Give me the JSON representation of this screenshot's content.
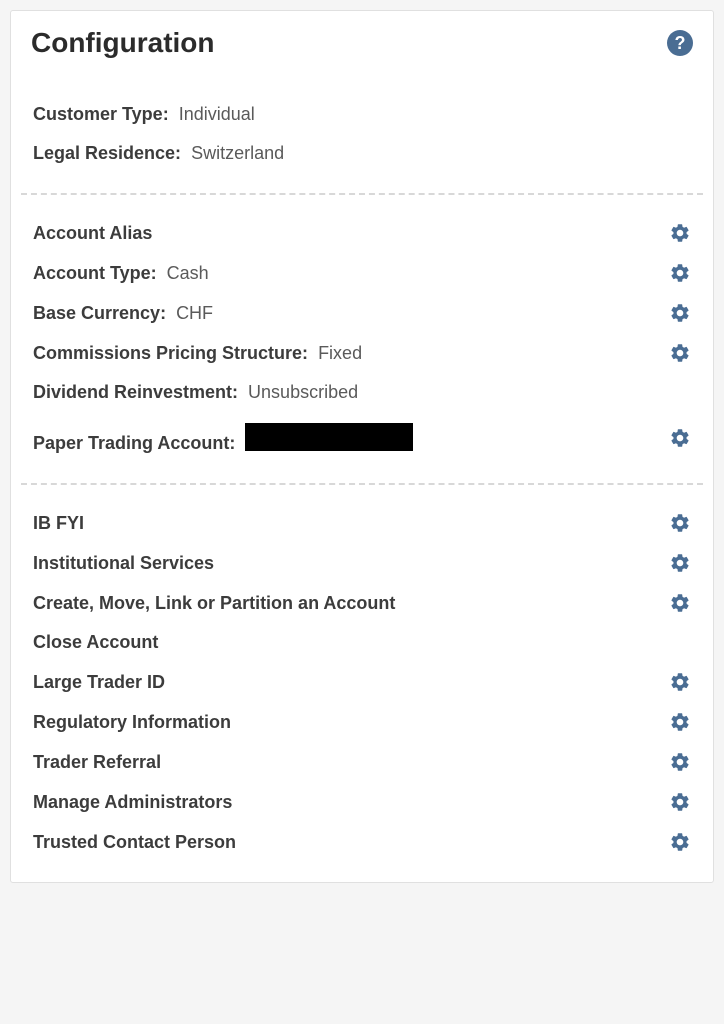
{
  "header": {
    "title": "Configuration"
  },
  "info": {
    "customer_type_label": "Customer Type:",
    "customer_type_value": "Individual",
    "legal_residence_label": "Legal Residence:",
    "legal_residence_value": "Switzerland"
  },
  "settings": [
    {
      "label": "Account Alias",
      "value": "",
      "gear": true
    },
    {
      "label": "Account Type:",
      "value": "Cash",
      "gear": true
    },
    {
      "label": "Base Currency:",
      "value": "CHF",
      "gear": true
    },
    {
      "label": "Commissions Pricing Structure:",
      "value": "Fixed",
      "gear": true
    },
    {
      "label": "Dividend Reinvestment:",
      "value": "Unsubscribed",
      "gear": false
    },
    {
      "label": "Paper Trading Account:",
      "value": "",
      "redacted": true,
      "gear": true
    }
  ],
  "links": [
    {
      "label": "IB FYI",
      "gear": true
    },
    {
      "label": "Institutional Services",
      "gear": true
    },
    {
      "label": "Create, Move, Link or Partition an Account",
      "gear": true
    },
    {
      "label": "Close Account",
      "gear": false
    },
    {
      "label": "Large Trader ID",
      "gear": true
    },
    {
      "label": "Regulatory Information",
      "gear": true
    },
    {
      "label": "Trader Referral",
      "gear": true
    },
    {
      "label": "Manage Administrators",
      "gear": true
    },
    {
      "label": "Trusted Contact Person",
      "gear": true
    }
  ]
}
